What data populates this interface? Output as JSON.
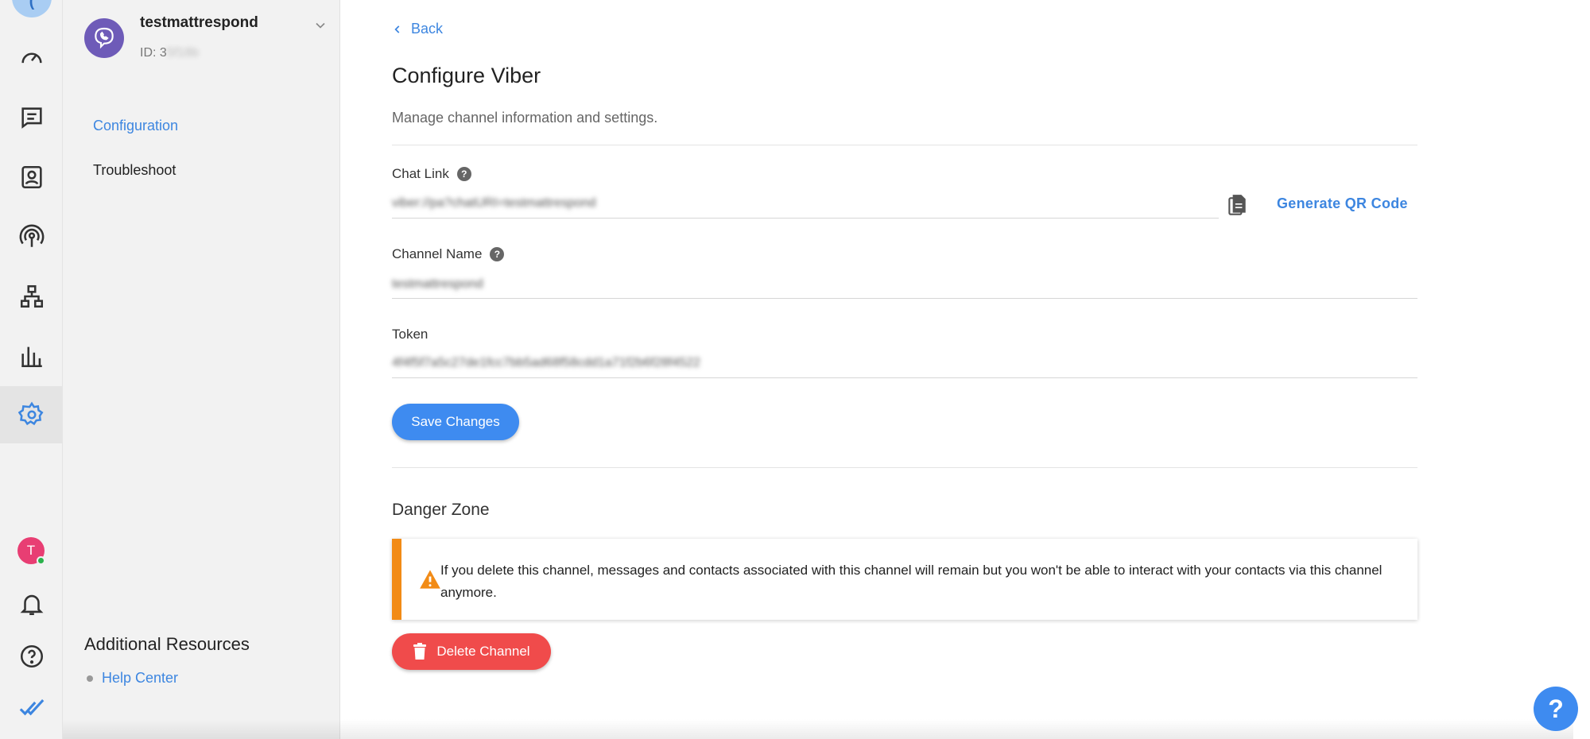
{
  "rail": {
    "top_glyph": "(",
    "avatar_initial": "T",
    "items": [
      {
        "icon": "dashboard-gauge-icon"
      },
      {
        "icon": "messages-icon"
      },
      {
        "icon": "contacts-icon"
      },
      {
        "icon": "broadcast-icon"
      },
      {
        "icon": "workflows-icon"
      },
      {
        "icon": "reports-icon"
      },
      {
        "icon": "settings-gear-icon",
        "active": true
      }
    ],
    "bottom_items": [
      {
        "icon": "notifications-bell-icon"
      },
      {
        "icon": "help-circle-icon"
      },
      {
        "icon": "double-check-logo-icon"
      }
    ]
  },
  "sidebar": {
    "channel_name": "testmattrespond",
    "channel_id_label": "ID: ",
    "channel_id_visible": "3",
    "channel_id_blurred": "5f18b",
    "nav": [
      {
        "label": "Configuration",
        "active": true
      },
      {
        "label": "Troubleshoot",
        "active": false
      }
    ],
    "resources_title": "Additional Resources",
    "resources_links": [
      {
        "label": "Help Center"
      }
    ]
  },
  "main": {
    "back_label": "Back",
    "title": "Configure Viber",
    "subtitle": "Manage channel information and settings.",
    "chat_link": {
      "label": "Chat Link",
      "value": "viber://pa?chatURI=testmattrespond"
    },
    "generate_qr_label": "Generate QR Code",
    "channel_name": {
      "label": "Channel Name",
      "value": "testmattrespond"
    },
    "token": {
      "label": "Token",
      "value": "4f4f5f7a5c27de1fcc7bb5ad68f58cdd1a71f2b6f28f4522"
    },
    "save_label": "Save Changes",
    "danger_title": "Danger Zone",
    "danger_text": "If you delete this channel, messages and contacts associated with this channel will remain but you won't be able to interact with your contacts via this channel anymore.",
    "delete_label": "Delete Channel"
  },
  "help_fab": "?",
  "colors": {
    "accent": "#3d86e0",
    "primary_button": "#3e8bf0",
    "danger_button": "#f04b4b",
    "warning": "#f28b16",
    "viber": "#6e5bb8",
    "avatar": "#e83e73"
  }
}
